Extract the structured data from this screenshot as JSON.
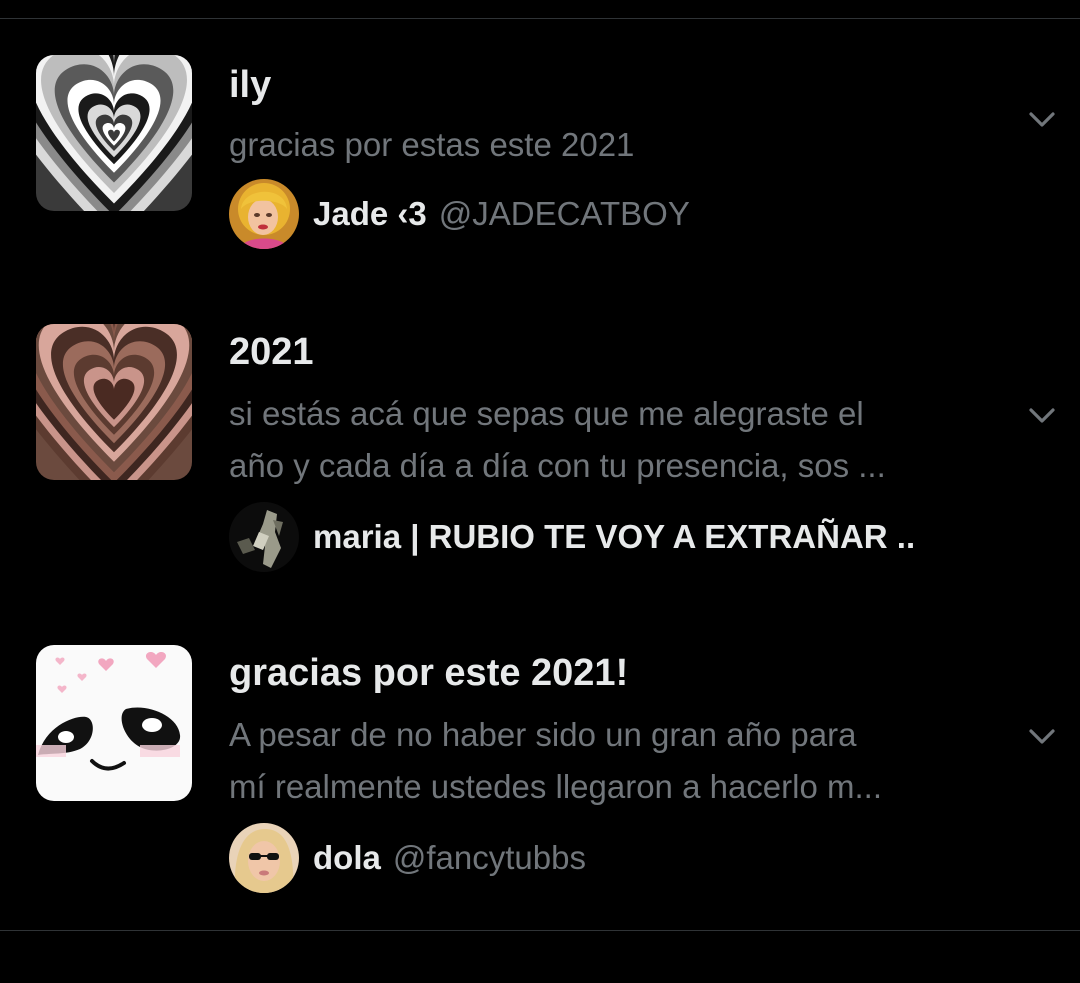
{
  "lists": [
    {
      "title": "ily",
      "description_lines": [
        "gracias por estas este 2021"
      ],
      "owner": {
        "name": "Jade ‹3",
        "handle": "@JADECATBOY"
      },
      "thumbnail_icon": "grey-concentric-heart-icon",
      "more_icon": "chevron-down-icon"
    },
    {
      "title": "2021",
      "description_lines": [
        "si estás acá que sepas que me alegraste el",
        "año y cada día a día con tu presencia, sos ..."
      ],
      "owner": {
        "name": "maria | RUBIO TE VOY A EXTRAÑAR ..",
        "handle": ""
      },
      "thumbnail_icon": "brown-concentric-heart-icon",
      "more_icon": "chevron-down-icon"
    },
    {
      "title": "gracias por este 2021!",
      "description_lines": [
        "A pesar de no haber sido un gran año para",
        "mí realmente ustedes llegaron a hacerlo m..."
      ],
      "owner": {
        "name": "dola",
        "handle": "@fancytubbs"
      },
      "thumbnail_icon": "smiling-face-hearts-icon",
      "more_icon": "chevron-down-icon"
    }
  ],
  "colors": {
    "background": "#000000",
    "primary_text": "#e7e9ea",
    "secondary_text": "#71767b",
    "divider": "#2f3336"
  }
}
